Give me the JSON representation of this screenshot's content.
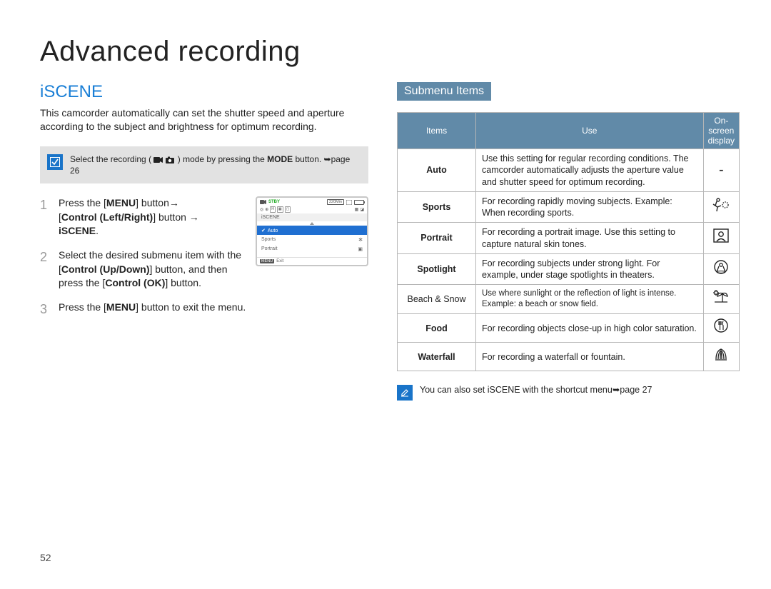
{
  "page": {
    "title": "Advanced recording",
    "number": "52"
  },
  "left": {
    "heading": "iSCENE",
    "intro": "This camcorder automatically can set the shutter speed and aperture according to the subject and brightness for optimum recording.",
    "note": {
      "prefix": "Select the recording (",
      "suffix": ") mode by pressing the ",
      "button_label": "MODE",
      "tail": " button. ➥page 26"
    },
    "steps": [
      {
        "num": "1",
        "text": "Press the [MENU] button→ [Control (Left/Right)] button → iSCENE.",
        "bold_segments": [
          "MENU",
          "Control (Left/Right)",
          "iSCENE"
        ]
      },
      {
        "num": "2",
        "text": "Select the desired submenu item with the [Control (Up/Down)] button, and then press the [Control (OK)] button.",
        "bold_segments": [
          "Control (Up/Down)",
          "Control (OK)"
        ]
      },
      {
        "num": "3",
        "text": "Press the [MENU] button to exit the menu.",
        "bold_segments": [
          "MENU"
        ]
      }
    ],
    "lcd": {
      "stby": "STBY",
      "time_bracket": "220Min",
      "menu_label": "iSCENE",
      "options": [
        {
          "label": "Auto",
          "selected": true,
          "icon": "check"
        },
        {
          "label": "Sports",
          "selected": false
        },
        {
          "label": "Portrait",
          "selected": false
        }
      ],
      "exit_tag": "MENU",
      "exit_label": "Exit"
    }
  },
  "right": {
    "heading": "Submenu Items",
    "table": {
      "headers": [
        "Items",
        "Use",
        "On-screen display"
      ],
      "rows": [
        {
          "item": "Auto",
          "use": "Use this setting for regular recording conditions. The camcorder automatically adjusts the aperture value and shutter speed for optimum recording.",
          "icon": "-"
        },
        {
          "item": "Sports",
          "use": "For recording rapidly moving subjects. Example: When recording sports.",
          "icon": "sports"
        },
        {
          "item": "Portrait",
          "use": "For recording a portrait image. Use this setting to capture natural skin tones.",
          "icon": "portrait"
        },
        {
          "item": "Spotlight",
          "use": "For recording subjects under strong light. For example, under stage spotlights in theaters.",
          "icon": "spotlight"
        },
        {
          "item": "Beach & Snow",
          "use": "Use where sunlight or the reflection of light is intense. Example: a beach or snow field.",
          "icon": "beach"
        },
        {
          "item": "Food",
          "use": "For recording objects close-up in high color saturation.",
          "icon": "food"
        },
        {
          "item": "Waterfall",
          "use": "For recording a waterfall or fountain.",
          "icon": "waterfall"
        }
      ]
    },
    "shortcut": "You can also set iSCENE with the shortcut menu➥page 27"
  }
}
